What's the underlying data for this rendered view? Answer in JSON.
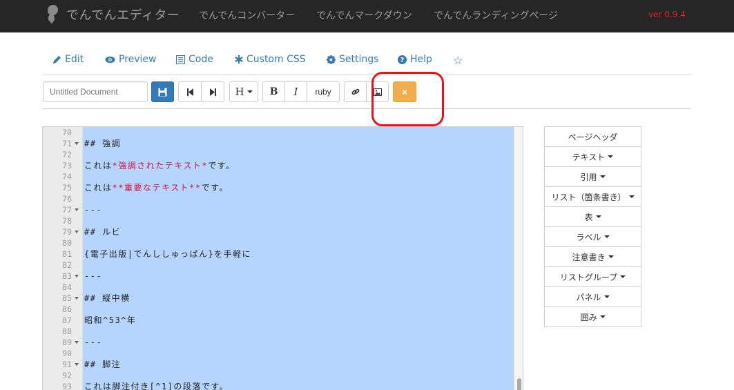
{
  "navbar": {
    "brand": "でんでんエディター",
    "links": [
      "でんでんコンバーター",
      "でんでんマークダウン",
      "でんでんランディングページ"
    ],
    "version": "ver 0.9.4"
  },
  "tabs": [
    {
      "label": "Edit",
      "icon": "pencil-icon"
    },
    {
      "label": "Preview",
      "icon": "eye-icon"
    },
    {
      "label": "Code",
      "icon": "code-icon"
    },
    {
      "label": "Custom CSS",
      "icon": "asterisk-icon"
    },
    {
      "label": "Settings",
      "icon": "gear-icon"
    },
    {
      "label": "Help",
      "icon": "question-icon"
    },
    {
      "label": "",
      "icon": "star-icon"
    }
  ],
  "toolbar": {
    "doc_placeholder": "Untitled Document",
    "heading_label": "H",
    "bold_label": "B",
    "italic_label": "I",
    "ruby_label": "ruby",
    "close_label": "×"
  },
  "editor": {
    "lines": [
      {
        "n": "70",
        "fold": false,
        "segments": []
      },
      {
        "n": "71",
        "fold": true,
        "segments": [
          {
            "t": "## 強調",
            "em": false
          }
        ]
      },
      {
        "n": "72",
        "fold": false,
        "segments": []
      },
      {
        "n": "73",
        "fold": false,
        "segments": [
          {
            "t": "これは",
            "em": false
          },
          {
            "t": "*強調されたテキスト*",
            "em": true
          },
          {
            "t": "です。",
            "em": false
          }
        ]
      },
      {
        "n": "74",
        "fold": false,
        "segments": []
      },
      {
        "n": "75",
        "fold": false,
        "segments": [
          {
            "t": "これは",
            "em": false
          },
          {
            "t": "**重要なテキスト**",
            "em": true
          },
          {
            "t": "です。",
            "em": false
          }
        ]
      },
      {
        "n": "76",
        "fold": false,
        "segments": []
      },
      {
        "n": "77",
        "fold": true,
        "segments": [
          {
            "t": "---",
            "em": false
          }
        ]
      },
      {
        "n": "78",
        "fold": false,
        "segments": []
      },
      {
        "n": "79",
        "fold": true,
        "segments": [
          {
            "t": "## ルビ",
            "em": false
          }
        ]
      },
      {
        "n": "80",
        "fold": false,
        "segments": []
      },
      {
        "n": "81",
        "fold": false,
        "segments": [
          {
            "t": "{電子出版|でんししゅっぱん}を手軽に",
            "em": false
          }
        ]
      },
      {
        "n": "82",
        "fold": false,
        "segments": []
      },
      {
        "n": "83",
        "fold": true,
        "segments": [
          {
            "t": "---",
            "em": false
          }
        ]
      },
      {
        "n": "84",
        "fold": false,
        "segments": []
      },
      {
        "n": "85",
        "fold": true,
        "segments": [
          {
            "t": "## 縦中横",
            "em": false
          }
        ]
      },
      {
        "n": "86",
        "fold": false,
        "segments": []
      },
      {
        "n": "87",
        "fold": false,
        "segments": [
          {
            "t": "昭和^53^年",
            "em": false
          }
        ]
      },
      {
        "n": "88",
        "fold": false,
        "segments": []
      },
      {
        "n": "89",
        "fold": true,
        "segments": [
          {
            "t": "---",
            "em": false
          }
        ]
      },
      {
        "n": "90",
        "fold": false,
        "segments": []
      },
      {
        "n": "91",
        "fold": true,
        "segments": [
          {
            "t": "## 脚注",
            "em": false
          }
        ]
      },
      {
        "n": "92",
        "fold": false,
        "segments": []
      },
      {
        "n": "93",
        "fold": false,
        "segments": [
          {
            "t": "これは脚注付き[^1]の段落です。",
            "em": false
          }
        ]
      }
    ]
  },
  "sidebar": {
    "items": [
      {
        "label": "ページヘッダ",
        "dropdown": false
      },
      {
        "label": "テキスト",
        "dropdown": true
      },
      {
        "label": "引用",
        "dropdown": true
      },
      {
        "label": "リスト（箇条書き）",
        "dropdown": true
      },
      {
        "label": "表",
        "dropdown": true
      },
      {
        "label": "ラベル",
        "dropdown": true
      },
      {
        "label": "注意書き",
        "dropdown": true
      },
      {
        "label": "リストグループ",
        "dropdown": true
      },
      {
        "label": "パネル",
        "dropdown": true
      },
      {
        "label": "囲み",
        "dropdown": true
      }
    ]
  },
  "colors": {
    "navbar_bg": "#262626",
    "link": "#337ab7",
    "primary": "#337ab7",
    "warning": "#f0ad4e",
    "selection": "#b5d5ff",
    "emphasis": "#d1153d",
    "version": "#e0202a",
    "annotation_circle": "#e8141c"
  }
}
